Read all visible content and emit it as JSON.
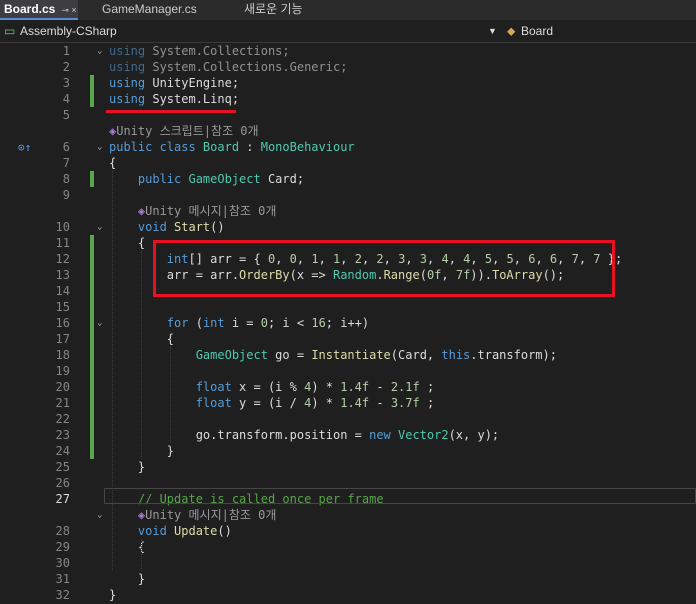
{
  "tabs": [
    {
      "label": "Board.cs",
      "active": true,
      "icons": "⊸ ×"
    },
    {
      "label": "GameManager.cs",
      "active": false,
      "icons": ""
    },
    {
      "label": "새로운 기능",
      "active": false,
      "icons": ""
    }
  ],
  "nav": {
    "project": "Assembly-CSharp",
    "class": "Board"
  },
  "colors": {
    "keyword": "#569cd6",
    "type": "#4ec9b0",
    "method": "#dcdcaa",
    "comment": "#57a64a",
    "number": "#b5cea8",
    "text": "#dcdcdc",
    "annotation": "#e81123"
  },
  "lines": [
    {
      "n": "1",
      "segs": [
        [
          "kw dim",
          "using"
        ],
        [
          "dim",
          " System.Collections;"
        ]
      ]
    },
    {
      "n": "2",
      "segs": [
        [
          "kw dim",
          "using"
        ],
        [
          "dim",
          " System.Collections.Generic;"
        ]
      ]
    },
    {
      "n": "3",
      "segs": [
        [
          "kw",
          "using"
        ],
        [
          "",
          " UnityEngine;"
        ]
      ]
    },
    {
      "n": "4",
      "segs": [
        [
          "kw",
          "using"
        ],
        [
          "",
          " System.Linq;"
        ]
      ]
    },
    {
      "n": "5",
      "segs": []
    },
    {
      "n": "",
      "lens": true,
      "segs": [
        [
          "cube",
          "◈"
        ],
        [
          "",
          "Unity 스크립트|참조 0개"
        ]
      ]
    },
    {
      "n": "6",
      "segs": [
        [
          "kw",
          "public class "
        ],
        [
          "ty",
          "Board"
        ],
        [
          "",
          " : "
        ],
        [
          "ty",
          "MonoBehaviour"
        ]
      ]
    },
    {
      "n": "7",
      "segs": [
        [
          "",
          "{"
        ]
      ]
    },
    {
      "n": "8",
      "segs": [
        [
          "",
          "    "
        ],
        [
          "kw",
          "public "
        ],
        [
          "ty",
          "GameObject"
        ],
        [
          "",
          " Card;"
        ]
      ]
    },
    {
      "n": "9",
      "segs": []
    },
    {
      "n": "",
      "lens": true,
      "segs": [
        [
          "",
          "    "
        ],
        [
          "cube",
          "◈"
        ],
        [
          "",
          "Unity 메시지|참조 0개"
        ]
      ]
    },
    {
      "n": "10",
      "segs": [
        [
          "",
          "    "
        ],
        [
          "kw",
          "void "
        ],
        [
          "fn",
          "Start"
        ],
        [
          "",
          "()"
        ]
      ]
    },
    {
      "n": "11",
      "segs": [
        [
          "",
          "    {"
        ]
      ]
    },
    {
      "n": "12",
      "segs": [
        [
          "",
          "        "
        ],
        [
          "kw",
          "int"
        ],
        [
          "",
          "[] arr = { "
        ],
        [
          "nu",
          "0"
        ],
        [
          ", ",
          ""
        ],
        [
          "nu",
          "0"
        ],
        [
          "",
          ", "
        ],
        [
          "nu",
          "1"
        ],
        [
          "",
          ", "
        ],
        [
          "nu",
          "1"
        ],
        [
          "",
          ", "
        ],
        [
          "nu",
          "2"
        ],
        [
          "",
          ", "
        ],
        [
          "nu",
          "2"
        ],
        [
          "",
          ", "
        ],
        [
          "nu",
          "3"
        ],
        [
          "",
          ", "
        ],
        [
          "nu",
          "3"
        ],
        [
          "",
          ", "
        ],
        [
          "nu",
          "4"
        ],
        [
          "",
          ", "
        ],
        [
          "nu",
          "4"
        ],
        [
          "",
          ", "
        ],
        [
          "nu",
          "5"
        ],
        [
          "",
          ", "
        ],
        [
          "nu",
          "5"
        ],
        [
          "",
          ", "
        ],
        [
          "nu",
          "6"
        ],
        [
          "",
          ", "
        ],
        [
          "nu",
          "6"
        ],
        [
          "",
          ", "
        ],
        [
          "nu",
          "7"
        ],
        [
          "",
          ", "
        ],
        [
          "nu",
          "7"
        ],
        [
          "",
          " };"
        ]
      ]
    },
    {
      "n": "13",
      "segs": [
        [
          "",
          "        arr = arr."
        ],
        [
          "fn",
          "OrderBy"
        ],
        [
          "",
          "(x => "
        ],
        [
          "ty",
          "Random"
        ],
        [
          "",
          "."
        ],
        [
          "fn",
          "Range"
        ],
        [
          "",
          "("
        ],
        [
          "nu",
          "0f"
        ],
        [
          "",
          ", "
        ],
        [
          "nu",
          "7f"
        ],
        [
          "",
          "))."
        ],
        [
          "fn",
          "ToArray"
        ],
        [
          "",
          "();"
        ]
      ]
    },
    {
      "n": "14",
      "segs": []
    },
    {
      "n": "15",
      "segs": []
    },
    {
      "n": "16",
      "segs": [
        [
          "",
          "        "
        ],
        [
          "kw",
          "for"
        ],
        [
          "",
          " ("
        ],
        [
          "kw",
          "int"
        ],
        [
          "",
          " i = "
        ],
        [
          "nu",
          "0"
        ],
        [
          "",
          "; i < "
        ],
        [
          "nu",
          "16"
        ],
        [
          "",
          "; i++)"
        ]
      ]
    },
    {
      "n": "17",
      "segs": [
        [
          "",
          "        {"
        ]
      ]
    },
    {
      "n": "18",
      "segs": [
        [
          "",
          "            "
        ],
        [
          "ty",
          "GameObject"
        ],
        [
          "",
          " go = "
        ],
        [
          "fn",
          "Instantiate"
        ],
        [
          "",
          "(Card, "
        ],
        [
          "kw",
          "this"
        ],
        [
          "",
          ".transform);"
        ]
      ]
    },
    {
      "n": "19",
      "segs": []
    },
    {
      "n": "20",
      "segs": [
        [
          "",
          "            "
        ],
        [
          "kw",
          "float"
        ],
        [
          "",
          " x = (i % "
        ],
        [
          "nu",
          "4"
        ],
        [
          "",
          ") * "
        ],
        [
          "nu",
          "1.4f"
        ],
        [
          "",
          " - "
        ],
        [
          "nu",
          "2.1f"
        ],
        [
          "",
          " ;"
        ]
      ]
    },
    {
      "n": "21",
      "segs": [
        [
          "",
          "            "
        ],
        [
          "kw",
          "float"
        ],
        [
          "",
          " y = (i / "
        ],
        [
          "nu",
          "4"
        ],
        [
          "",
          ") * "
        ],
        [
          "nu",
          "1.4f"
        ],
        [
          "",
          " - "
        ],
        [
          "nu",
          "3.7f"
        ],
        [
          "",
          " ;"
        ]
      ]
    },
    {
      "n": "22",
      "segs": []
    },
    {
      "n": "23",
      "segs": [
        [
          "",
          "            go.transform.position = "
        ],
        [
          "kw",
          "new "
        ],
        [
          "ty",
          "Vector2"
        ],
        [
          "",
          "(x, y);"
        ]
      ]
    },
    {
      "n": "24",
      "segs": [
        [
          "",
          "        }"
        ]
      ]
    },
    {
      "n": "25",
      "segs": [
        [
          "",
          "    }"
        ]
      ]
    },
    {
      "n": "26",
      "segs": []
    },
    {
      "n": "27",
      "current": true,
      "segs": [
        [
          "",
          "    "
        ],
        [
          "cm",
          "// Update is called once per frame"
        ]
      ]
    },
    {
      "n": "",
      "lens": true,
      "segs": [
        [
          "",
          "    "
        ],
        [
          "cube",
          "◈"
        ],
        [
          "",
          "Unity 메시지|참조 0개"
        ]
      ]
    },
    {
      "n": "28",
      "segs": [
        [
          "",
          "    "
        ],
        [
          "kw",
          "void "
        ],
        [
          "fn",
          "Update"
        ],
        [
          "",
          "()"
        ]
      ]
    },
    {
      "n": "29",
      "segs": [
        [
          "",
          "    {"
        ]
      ]
    },
    {
      "n": "30",
      "segs": []
    },
    {
      "n": "31",
      "segs": [
        [
          "",
          "    }"
        ]
      ]
    },
    {
      "n": "32",
      "segs": [
        [
          "",
          "}"
        ]
      ]
    }
  ]
}
